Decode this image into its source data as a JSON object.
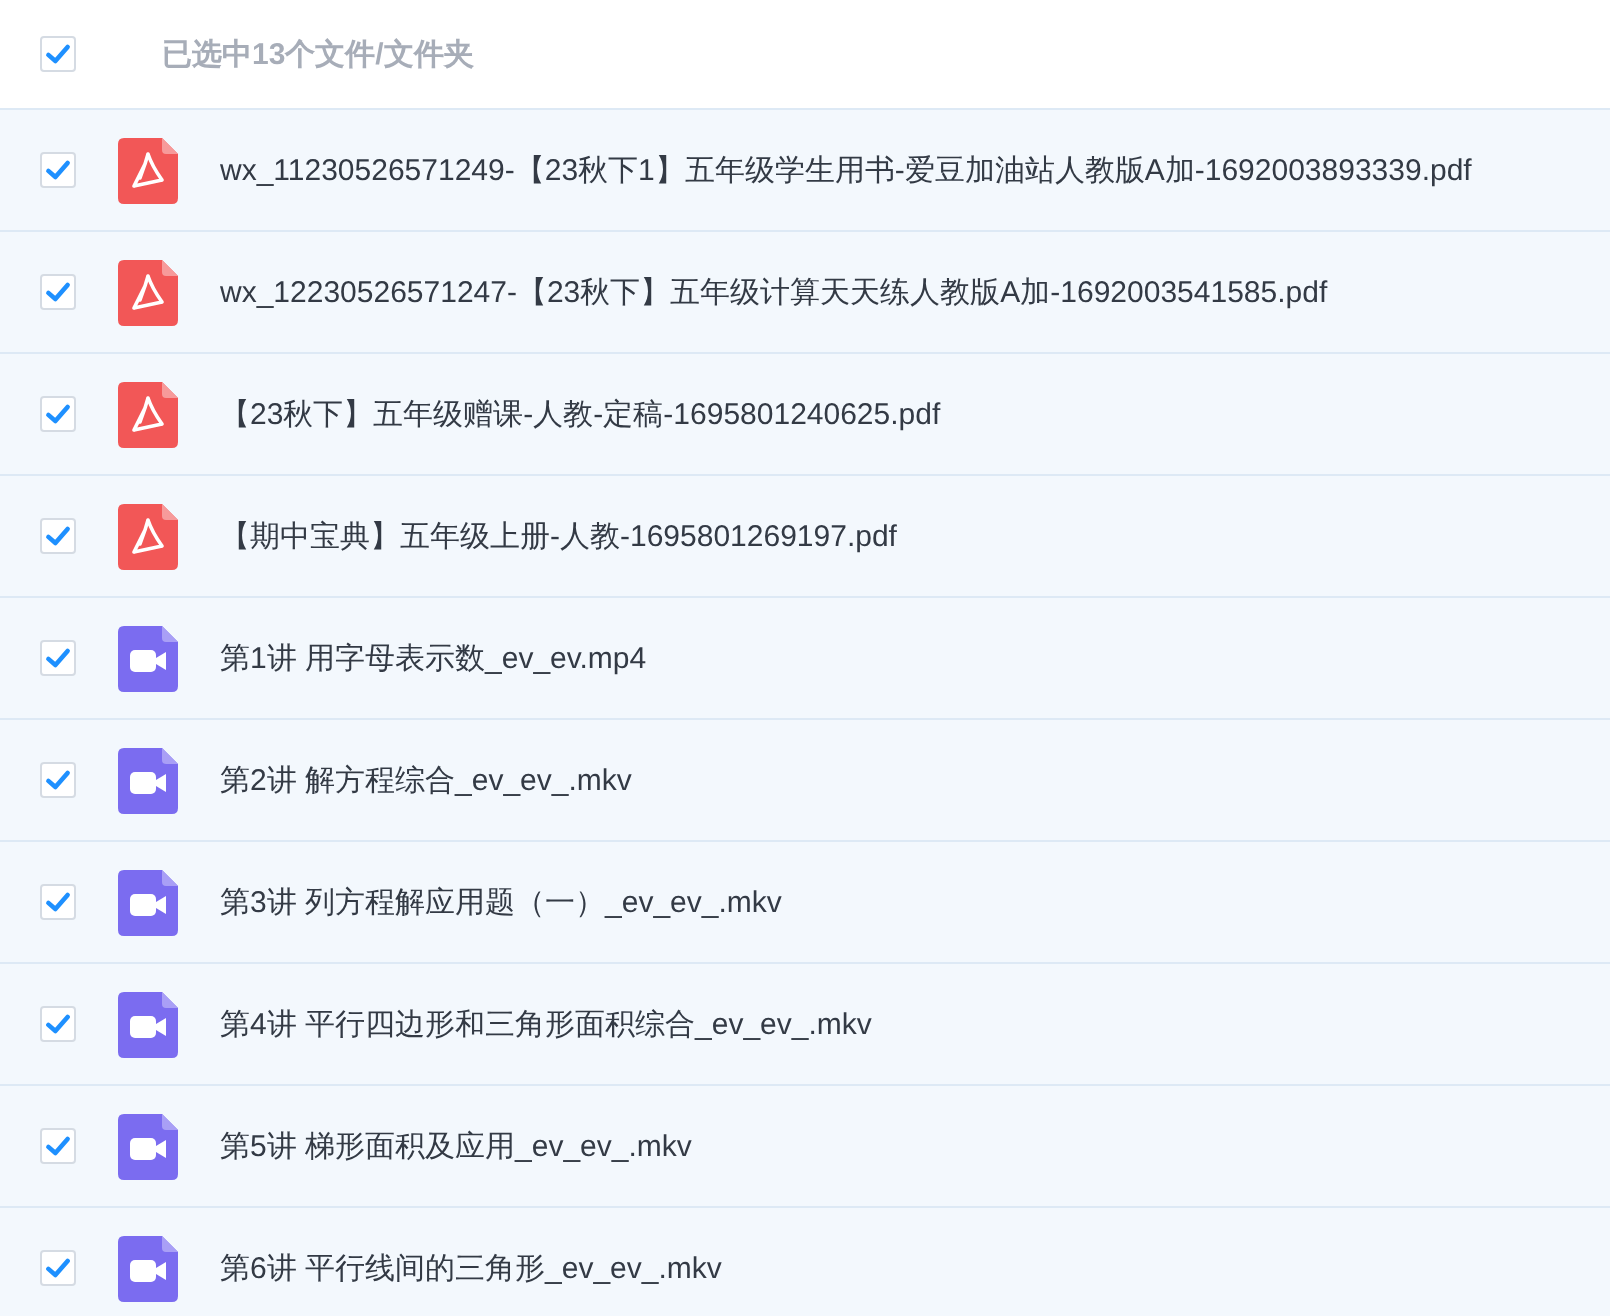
{
  "header": {
    "checked": true,
    "label": "已选中13个文件/文件夹"
  },
  "files": [
    {
      "kind": "pdf",
      "checked": true,
      "name": "wx_11230526571249-【23秋下1】五年级学生用书-爱豆加油站人教版A加-1692003893339.pdf"
    },
    {
      "kind": "pdf",
      "checked": true,
      "name": "wx_12230526571247-【23秋下】五年级计算天天练人教版A加-1692003541585.pdf"
    },
    {
      "kind": "pdf",
      "checked": true,
      "name": "【23秋下】五年级赠课-人教-定稿-1695801240625.pdf"
    },
    {
      "kind": "pdf",
      "checked": true,
      "name": "【期中宝典】五年级上册-人教-1695801269197.pdf"
    },
    {
      "kind": "video",
      "checked": true,
      "name": "第1讲 用字母表示数_ev_ev.mp4"
    },
    {
      "kind": "video",
      "checked": true,
      "name": "第2讲 解方程综合_ev_ev_.mkv"
    },
    {
      "kind": "video",
      "checked": true,
      "name": "第3讲 列方程解应用题（一）_ev_ev_.mkv"
    },
    {
      "kind": "video",
      "checked": true,
      "name": "第4讲 平行四边形和三角形面积综合_ev_ev_.mkv"
    },
    {
      "kind": "video",
      "checked": true,
      "name": "第5讲 梯形面积及应用_ev_ev_.mkv"
    },
    {
      "kind": "video",
      "checked": true,
      "name": "第6讲 平行线间的三角形_ev_ev_.mkv"
    }
  ]
}
